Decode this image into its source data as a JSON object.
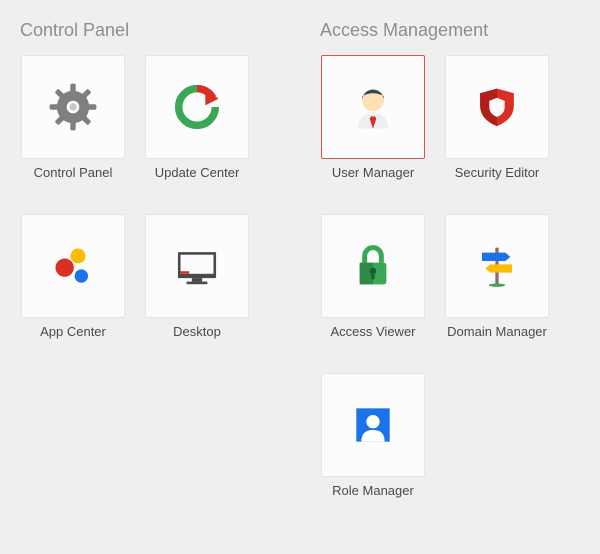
{
  "sections": [
    {
      "title": "Control Panel",
      "tiles": [
        {
          "label": "Control Panel",
          "icon": "gear-icon",
          "selected": false
        },
        {
          "label": "Update Center",
          "icon": "refresh-icon",
          "selected": false
        },
        {
          "label": "App Center",
          "icon": "dots-icon",
          "selected": false
        },
        {
          "label": "Desktop",
          "icon": "desktop-icon",
          "selected": false
        }
      ]
    },
    {
      "title": "Access Management",
      "tiles": [
        {
          "label": "User Manager",
          "icon": "user-tie-icon",
          "selected": true
        },
        {
          "label": "Security Editor",
          "icon": "shield-icon",
          "selected": false
        },
        {
          "label": "Access Viewer",
          "icon": "lock-icon",
          "selected": false
        },
        {
          "label": "Domain Manager",
          "icon": "signpost-icon",
          "selected": false
        },
        {
          "label": "Role Manager",
          "icon": "role-icon",
          "selected": false
        }
      ]
    }
  ]
}
